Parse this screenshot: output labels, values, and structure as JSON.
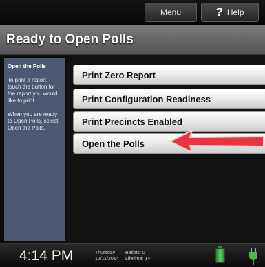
{
  "topbar": {
    "menu_label": "Menu",
    "help_icon_glyph": "?",
    "help_label": "Help"
  },
  "title": "Ready to Open Polls",
  "sidebar": {
    "heading": "Open the Polls",
    "text1": "To print a report, touch the button for the report you would like to print.",
    "text2": "When you are ready to Open Polls, select Open the Polls."
  },
  "buttons": {
    "zero_report": "Print Zero Report",
    "config_readiness": "Print Configuration Readiness",
    "precincts_enabled": "Print Precincts Enabled",
    "open_polls": "Open the Polls"
  },
  "status": {
    "time": "4:14 PM",
    "day": "Thursday",
    "date": "12/11/2014",
    "ballots": "Ballots: 0",
    "lifetime": "Lifetime: 14"
  },
  "colors": {
    "sidebar": "#4b5872",
    "arrow": "#e8343f",
    "battery": "#4cb84c"
  },
  "icons": {
    "help": "question-mark-icon",
    "battery": "battery-icon",
    "power": "power-plug-icon",
    "pointer": "red-arrow-annotation"
  }
}
